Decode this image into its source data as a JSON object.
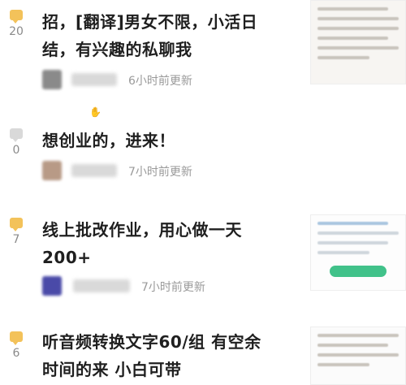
{
  "posts": [
    {
      "title_line1": "招，[翻译]男女不限，小活日",
      "title_line2": "结，有兴趣的私聊我",
      "comment_count": "20",
      "updated": "6小时前更新",
      "icon_color": "#f3c25a",
      "avatar_color": "#8a8a8a",
      "has_thumbnail": true
    },
    {
      "title_line1": "想创业的，进来！",
      "title_line2": "",
      "comment_count": "0",
      "updated": "7小时前更新",
      "icon_color": "#d9d9d9",
      "avatar_color": "#b89a86",
      "has_thumbnail": false
    },
    {
      "title_line1": "线上批改作业，用心做一天",
      "title_line2": "200+",
      "comment_count": "7",
      "updated": "7小时前更新",
      "icon_color": "#f3c25a",
      "avatar_color": "#4a4aa8",
      "has_thumbnail": true
    },
    {
      "title_line1": "听音频转换文字60/组 有空余",
      "title_line2": "时间的来 小白可带",
      "comment_count": "6",
      "updated": "",
      "icon_color": "#f3c25a",
      "avatar_color": "#8a8a8a",
      "has_thumbnail": true
    }
  ],
  "cursor_icon": "hand-pointer-icon"
}
